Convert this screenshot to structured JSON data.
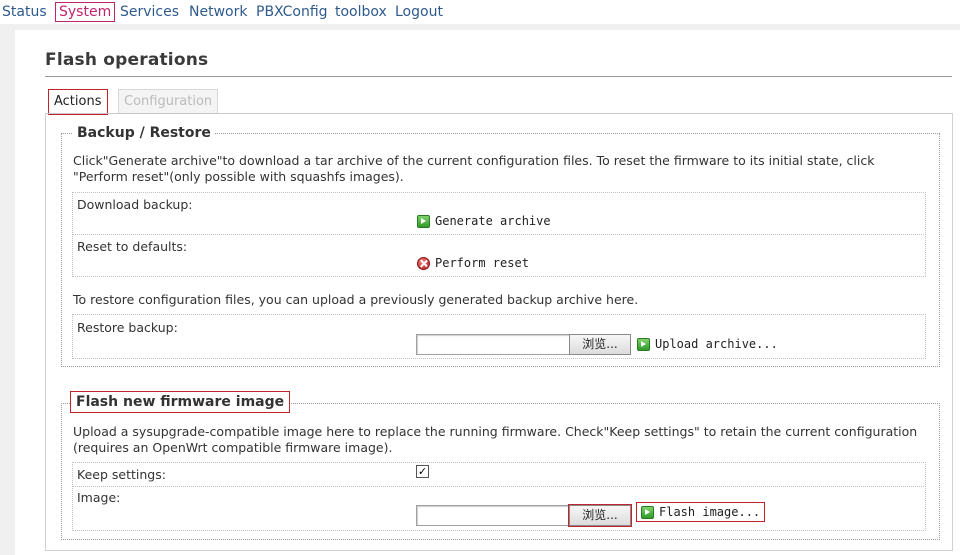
{
  "nav": {
    "items": [
      "Status",
      "System",
      "Services",
      "Network",
      "PBXConfig",
      "toolbox",
      "Logout"
    ],
    "active": "System"
  },
  "page": {
    "title": "Flash operations"
  },
  "tabs": [
    {
      "label": "Actions",
      "active": true
    },
    {
      "label": "Configuration",
      "active": false
    }
  ],
  "backup": {
    "legend": "Backup / Restore",
    "description": "Click\"Generate archive\"to download a tar archive of the current configuration files. To reset the firmware to its initial state, click \"Perform reset\"(only possible with squashfs images).",
    "download_label": "Download backup:",
    "generate_label": "Generate archive",
    "reset_label": "Reset to defaults:",
    "perform_reset_label": "Perform reset",
    "restore_description": "To restore configuration files, you can upload a previously generated backup archive here.",
    "restore_label": "Restore backup:",
    "browse_label": "浏览...",
    "upload_label": "Upload archive..."
  },
  "flash": {
    "legend": "Flash new firmware image",
    "description": "Upload a sysupgrade-compatible image here to replace the running firmware. Check\"Keep settings\" to retain the current configuration (requires an OpenWrt compatible firmware image).",
    "keep_label": "Keep settings:",
    "keep_checked": true,
    "image_label": "Image:",
    "browse_label": "浏览...",
    "flash_label": "Flash image..."
  },
  "colors": {
    "link": "#2f5a8c",
    "active": "#c0246c",
    "highlight_border": "#c0242c"
  }
}
